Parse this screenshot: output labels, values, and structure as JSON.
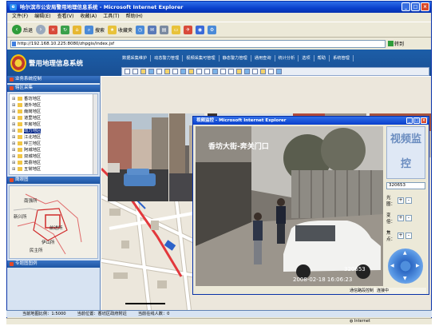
{
  "window": {
    "title": "哈尔滨市公安局警用地理信息系统 - Microsoft Internet Explorer",
    "logo": "e"
  },
  "menu": [
    "文件(F)",
    "编辑(E)",
    "查看(V)",
    "收藏(A)",
    "工具(T)",
    "帮助(H)"
  ],
  "toolbar": {
    "back": "后退",
    "search": "搜索",
    "favorites": "收藏夹"
  },
  "address": {
    "url": "http://192.168.10.225:8080/zhpgis/index.jsf",
    "go": "转到"
  },
  "app": {
    "brand": "警用地理信息系统",
    "nav": [
      "数据采集维护",
      "动态警力管理",
      "视频采集可管理",
      "静态警力管理",
      "通用查询",
      "统计分析",
      "选项",
      "帮助",
      "系统管理"
    ]
  },
  "left": {
    "control_header": "业务系统控制",
    "district_header": "辖区采集",
    "districts": [
      "香坊地区",
      "道外地区",
      "南岗地区",
      "道里地区",
      "平房地区",
      "动力地区",
      "江北地区",
      "呼兰地区",
      "阿城地区",
      "双城地区",
      "宾县地区",
      "五常地区"
    ],
    "selected_index": 5,
    "eagle_header": "鹰眼图",
    "eagle_labels": [
      "南强所",
      "新兴所",
      "前进所",
      "伊山所",
      "民主所"
    ],
    "thematic_header": "专题图图例"
  },
  "video_dialog": {
    "title": "视频监控 - Microsoft Internet Explorer",
    "overlay_text": "香坊大街-奔关门口",
    "timestamp": "2008-02-18 16:06:23",
    "plate": "320653",
    "device_id": "320653",
    "controls": [
      {
        "label": "光圈：",
        "plus": "+",
        "minus": "-"
      },
      {
        "label": "变倍：",
        "plus": "+",
        "minus": "-"
      },
      {
        "label": "焦点：",
        "plus": "+",
        "minus": "-"
      }
    ],
    "logo_text": "视频监控",
    "status": [
      "通信路段控制",
      "连接中"
    ]
  },
  "map": {
    "scale": "0",
    "labels": [
      "香坊区",
      "旭东街",
      "和平路"
    ]
  },
  "status": {
    "left": "当前地图比例：1:5000",
    "middle": "当前位置：香坊区政府附近",
    "right": "当前在线人数：0"
  },
  "ie_status": {
    "zone": "Internet"
  }
}
